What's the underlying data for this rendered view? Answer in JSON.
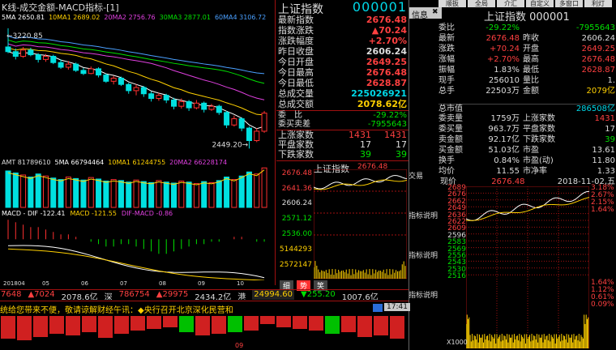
{
  "kline": {
    "title": "K线-成交金额-MACD指标-[1]",
    "ma": [
      {
        "label": "5MA 2650.81",
        "color": "#ffffff"
      },
      {
        "label": "10MA1 2689.02",
        "color": "#ffd000"
      },
      {
        "label": "20MA2 2756.76",
        "color": "#e040e0"
      },
      {
        "label": "30MA3 2877.01",
        "color": "#00e000"
      },
      {
        "label": "60MA4 3106.72",
        "color": "#4aa0ff"
      }
    ],
    "high_mark": "3220.85",
    "low_mark": "2449.20",
    "candles": [
      {
        "o": 3100,
        "c": 3070,
        "h": 3220,
        "l": 3060
      },
      {
        "o": 3070,
        "c": 3040,
        "h": 3090,
        "l": 3020
      },
      {
        "o": 3040,
        "c": 3080,
        "h": 3100,
        "l": 3030
      },
      {
        "o": 3080,
        "c": 3050,
        "h": 3095,
        "l": 3040
      },
      {
        "o": 3050,
        "c": 3020,
        "h": 3060,
        "l": 3000
      },
      {
        "o": 3020,
        "c": 3040,
        "h": 3055,
        "l": 3005
      },
      {
        "o": 3040,
        "c": 3000,
        "h": 3050,
        "l": 2990
      },
      {
        "o": 3000,
        "c": 2970,
        "h": 3020,
        "l": 2960
      },
      {
        "o": 2970,
        "c": 2990,
        "h": 3010,
        "l": 2955
      },
      {
        "o": 2990,
        "c": 2950,
        "h": 3000,
        "l": 2940
      },
      {
        "o": 2950,
        "c": 2930,
        "h": 2965,
        "l": 2920
      },
      {
        "o": 2930,
        "c": 2960,
        "h": 2975,
        "l": 2925
      },
      {
        "o": 2960,
        "c": 2920,
        "h": 2970,
        "l": 2905
      },
      {
        "o": 2920,
        "c": 2880,
        "h": 2930,
        "l": 2870
      },
      {
        "o": 2880,
        "c": 2900,
        "h": 2915,
        "l": 2860
      },
      {
        "o": 2900,
        "c": 2860,
        "h": 2910,
        "l": 2850
      },
      {
        "o": 2860,
        "c": 2820,
        "h": 2870,
        "l": 2800
      },
      {
        "o": 2820,
        "c": 2840,
        "h": 2860,
        "l": 2790
      },
      {
        "o": 2840,
        "c": 2800,
        "h": 2850,
        "l": 2780
      },
      {
        "o": 2800,
        "c": 2770,
        "h": 2815,
        "l": 2750
      },
      {
        "o": 2770,
        "c": 2790,
        "h": 2805,
        "l": 2755
      },
      {
        "o": 2790,
        "c": 2760,
        "h": 2800,
        "l": 2740
      },
      {
        "o": 2760,
        "c": 2720,
        "h": 2775,
        "l": 2700
      },
      {
        "o": 2720,
        "c": 2750,
        "h": 2770,
        "l": 2705
      },
      {
        "o": 2750,
        "c": 2710,
        "h": 2760,
        "l": 2690
      },
      {
        "o": 2710,
        "c": 2740,
        "h": 2760,
        "l": 2700
      },
      {
        "o": 2740,
        "c": 2700,
        "h": 2750,
        "l": 2680
      },
      {
        "o": 2700,
        "c": 2720,
        "h": 2735,
        "l": 2690
      },
      {
        "o": 2720,
        "c": 2680,
        "h": 2730,
        "l": 2665
      },
      {
        "o": 2680,
        "c": 2600,
        "h": 2690,
        "l": 2580
      },
      {
        "o": 2600,
        "c": 2640,
        "h": 2660,
        "l": 2590
      },
      {
        "o": 2640,
        "c": 2580,
        "h": 2650,
        "l": 2560
      },
      {
        "o": 2580,
        "c": 2500,
        "h": 2590,
        "l": 2449
      },
      {
        "o": 2500,
        "c": 2560,
        "h": 2580,
        "l": 2490
      },
      {
        "o": 2560,
        "c": 2676,
        "h": 2690,
        "l": 2550
      }
    ],
    "amt_label": "AMT 81789610",
    "amt_ma": [
      {
        "label": "5MA 66794464",
        "color": "#ffffff"
      },
      {
        "label": "10MA1 61244755",
        "color": "#ffd000"
      },
      {
        "label": "20MA2 66228174",
        "color": "#e040e0"
      }
    ],
    "volumes": [
      72,
      68,
      64,
      60,
      66,
      62,
      58,
      55,
      60,
      57,
      54,
      59,
      56,
      52,
      55,
      53,
      50,
      54,
      51,
      49,
      53,
      50,
      48,
      52,
      50,
      47,
      51,
      49,
      53,
      60,
      55,
      62,
      70,
      66,
      78
    ],
    "macd_labels": [
      {
        "label": "MACD - DIF -122.41",
        "color": "#ffffff"
      },
      {
        "label": "MACD -121.55",
        "color": "#ffd000"
      },
      {
        "label": "DIF-MACD -0.86",
        "color": "#e040e0"
      }
    ],
    "macd_hist": [
      8,
      7,
      6,
      5,
      5,
      4,
      3,
      2,
      2,
      1,
      0,
      -1,
      -2,
      -3,
      -3,
      -2,
      -2,
      -3,
      -4,
      -5,
      -6,
      -6,
      -5,
      -4,
      -3,
      -2,
      -2,
      -1,
      -1,
      0,
      1,
      1,
      0,
      -1,
      -1
    ],
    "dates": [
      "201804",
      "05",
      "06",
      "07",
      "08",
      "09",
      "10"
    ]
  },
  "quote": {
    "name": "上证指数",
    "code": "000001",
    "rows": [
      {
        "label": "最新指数",
        "value": "2676.48",
        "color": "r"
      },
      {
        "label": "指数涨跌",
        "value": "▲70.24",
        "color": "r"
      },
      {
        "label": "涨跌幅度",
        "value": "+2.70%",
        "color": "r"
      },
      {
        "label": "昨日收盘",
        "value": "2606.24",
        "color": "w"
      },
      {
        "label": "今日开盘",
        "value": "2649.25",
        "color": "r"
      },
      {
        "label": "今日最高",
        "value": "2676.48",
        "color": "r"
      },
      {
        "label": "今日最低",
        "value": "2628.87",
        "color": "r"
      },
      {
        "label": "总成交量",
        "value": "225026921",
        "color": "c"
      },
      {
        "label": "总成交额",
        "value": "2078.62亿",
        "color": "y"
      }
    ],
    "webi_label": "委　比",
    "webi_value": "-29.22%",
    "weicha_label": "委买卖差",
    "weicha_value": "-7955643",
    "updown": [
      {
        "label": "上涨家数",
        "v1": "1431",
        "v2": "1431",
        "color": "r"
      },
      {
        "label": "平盘家数",
        "v1": "17",
        "v2": "17",
        "color": "w"
      },
      {
        "label": "下跌家数",
        "v1": "39",
        "v2": "39",
        "color": "g"
      }
    ]
  },
  "mini": {
    "title": "上证指数",
    "price": "2676.48",
    "axis": [
      "2676.48",
      "2641.36",
      "2606.24",
      "2571.12",
      "2536.00",
      "5144293",
      "2572147"
    ],
    "tabs": [
      "细",
      "势",
      "笑"
    ]
  },
  "far": {
    "tabs": [
      "信息",
      "✖"
    ],
    "toolbar": [
      "顺扳",
      "全局",
      "介汇",
      "自定义",
      "多窗口",
      "利灯"
    ],
    "title": "上证指数 000001",
    "rows": [
      {
        "l1": "委比",
        "v1": "-29.22%",
        "c1": "g",
        "l2": "",
        "v2": "-7955643",
        "c2": "g"
      },
      {
        "l1": "最新",
        "v1": "2676.48",
        "c1": "r",
        "l2": "昨收",
        "v2": "2606.24",
        "c2": "w"
      },
      {
        "l1": "涨跌",
        "v1": "+70.24",
        "c1": "r",
        "l2": "开盘",
        "v2": "2649.25",
        "c2": "r"
      },
      {
        "l1": "涨幅",
        "v1": "+2.70%",
        "c1": "r",
        "l2": "最高",
        "v2": "2676.48",
        "c2": "r"
      },
      {
        "l1": "振幅",
        "v1": "1.83%",
        "c1": "w",
        "l2": "最低",
        "v2": "2628.87",
        "c2": "r"
      },
      {
        "l1": "现手",
        "v1": "256010",
        "c1": "w",
        "l2": "量比",
        "v2": "1.",
        "c2": "w"
      },
      {
        "l1": "总手",
        "v1": "22503万",
        "c1": "w",
        "l2": "金额",
        "v2": "2079亿",
        "c2": "y"
      }
    ],
    "stats_head": {
      "label": "总市值",
      "value": "286508亿"
    },
    "stats": [
      {
        "l1": "委卖量",
        "v1": "1759万",
        "c1": "w",
        "l2": "上涨家数",
        "v2": "1431",
        "c2": "r"
      },
      {
        "l1": "委买量",
        "v1": "963.7万",
        "c1": "w",
        "l2": "平盘家数",
        "v2": "17",
        "c2": "w"
      },
      {
        "l1": "卖金额",
        "v1": "92.17亿",
        "c1": "w",
        "l2": "下跌家数",
        "v2": "39",
        "c2": "g"
      },
      {
        "l1": "买金额",
        "v1": "51.03亿",
        "c1": "w",
        "l2": "市盈",
        "v2": "13.61",
        "c2": "w"
      },
      {
        "l1": "换手",
        "v1": "0.84%",
        "c1": "w",
        "l2": "市盈(动)",
        "v2": "11.80",
        "c2": "w"
      },
      {
        "l1": "均价",
        "v1": "11.55",
        "c1": "w",
        "l2": "市净率",
        "v2": "1.33",
        "c2": "w"
      }
    ],
    "chart_head": {
      "label": "现价",
      "price": "2676.48",
      "date": "2018-11-02,五"
    },
    "yleft": [
      "2689",
      "2676",
      "2662",
      "2649",
      "2636",
      "2622",
      "2609",
      "2596",
      "2583",
      "2569",
      "2556",
      "2543",
      "2530",
      "2516"
    ],
    "yright": [
      "3.18%",
      "2.67%",
      "2.15%",
      "1.64%"
    ],
    "ylower": [
      "1.64%",
      "1.12%",
      "0.61%",
      "0.09%"
    ],
    "vol_label": "X1000"
  },
  "side_labels": [
    "交易",
    "指标说明",
    "指标说明",
    "指标说明"
  ],
  "bottom": {
    "market": [
      {
        "text": "7648",
        "color": "r"
      },
      {
        "text": "▲7024",
        "color": "r"
      },
      {
        "text": "2078.6亿",
        "color": "w"
      },
      {
        "text": "深",
        "color": "w"
      },
      {
        "text": "786754",
        "color": "r"
      },
      {
        "text": "▲29975",
        "color": "r"
      },
      {
        "text": "2434.2亿",
        "color": "w"
      },
      {
        "text": "港",
        "color": "w"
      },
      {
        "text": "24994.60",
        "color": "y"
      },
      {
        "text": "▼255.20",
        "color": "g"
      },
      {
        "text": "1007.6亿",
        "color": "w"
      }
    ],
    "ticker": "统给您带来不便，敬请谅解财经午讯：◆央行召开北京深化民营和",
    "time": "17:41",
    "date_tick": "09"
  }
}
